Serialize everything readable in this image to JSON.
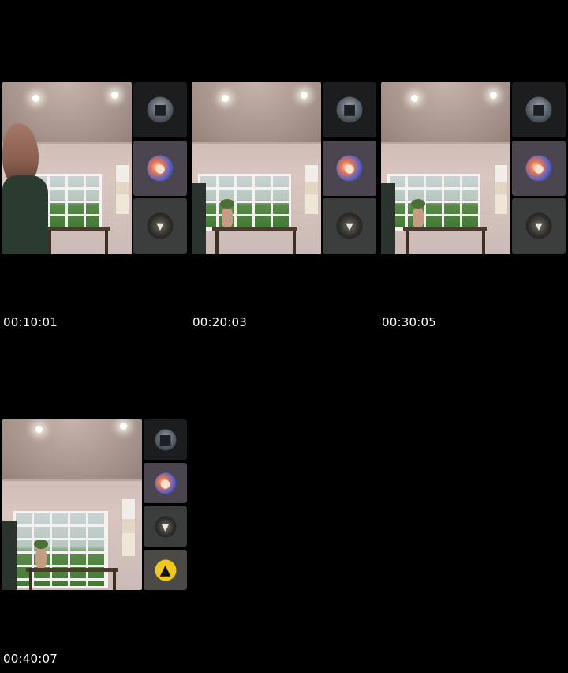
{
  "frames": [
    {
      "timestamp": "00:10:01",
      "participants": [
        {
          "avatar_icon": "person-dark-icon"
        },
        {
          "avatar_icon": "cartoon-character-icon"
        },
        {
          "avatar_icon": "dark-logo-icon"
        }
      ]
    },
    {
      "timestamp": "00:20:03",
      "participants": [
        {
          "avatar_icon": "person-dark-icon"
        },
        {
          "avatar_icon": "cartoon-character-icon"
        },
        {
          "avatar_icon": "dark-logo-icon"
        }
      ]
    },
    {
      "timestamp": "00:30:05",
      "participants": [
        {
          "avatar_icon": "person-dark-icon"
        },
        {
          "avatar_icon": "cartoon-character-icon"
        },
        {
          "avatar_icon": "dark-logo-icon"
        }
      ]
    },
    {
      "timestamp": "00:40:07",
      "participants": [
        {
          "avatar_icon": "person-dark-icon"
        },
        {
          "avatar_icon": "cartoon-character-icon"
        },
        {
          "avatar_icon": "dark-logo-icon"
        },
        {
          "avatar_icon": "gorilla-icon"
        }
      ]
    }
  ],
  "colors": {
    "background": "#000000",
    "timestamp_text": "#ffffff",
    "tile_dark": "#1c1d1f",
    "tile_purple": "#4b4550",
    "tile_gray": "#3c3e3e",
    "avatar_yellow": "#f0c81c"
  }
}
